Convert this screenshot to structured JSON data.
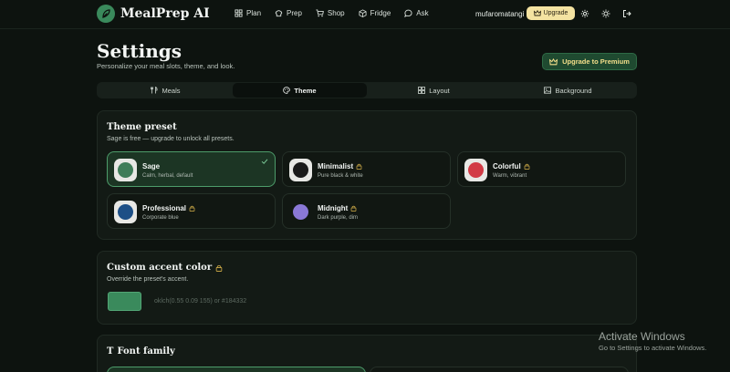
{
  "app": {
    "name": "MealPrep AI",
    "brand_color": "#3a8a5c",
    "accent_gold": "#f4e3a1"
  },
  "nav": {
    "items": [
      {
        "label": "Plan",
        "icon": "grid-icon"
      },
      {
        "label": "Prep",
        "icon": "chef-hat-icon"
      },
      {
        "label": "Shop",
        "icon": "cart-icon"
      },
      {
        "label": "Fridge",
        "icon": "box-icon"
      },
      {
        "label": "Ask",
        "icon": "chat-icon"
      }
    ],
    "username": "mufaromatangi",
    "upgrade_label": "Upgrade"
  },
  "header": {
    "title": "Settings",
    "subtitle": "Personalize your meal slots, theme, and look.",
    "premium_button": "Upgrade to Premium"
  },
  "tabs": [
    {
      "label": "Meals",
      "icon": "utensils-icon",
      "active": false
    },
    {
      "label": "Theme",
      "icon": "palette-icon",
      "active": true
    },
    {
      "label": "Layout",
      "icon": "layout-icon",
      "active": false
    },
    {
      "label": "Background",
      "icon": "image-icon",
      "active": false
    }
  ],
  "theme_preset": {
    "title": "Theme preset",
    "subtitle": "Sage is free — upgrade to unlock all presets.",
    "presets": [
      {
        "name": "Sage",
        "desc": "Calm, herbal, default",
        "color": "#3f7d59",
        "locked": false,
        "selected": true
      },
      {
        "name": "Minimalist",
        "desc": "Pure black & white",
        "color": "#1a1a1a",
        "locked": true,
        "selected": false
      },
      {
        "name": "Colorful",
        "desc": "Warm, vibrant",
        "color": "#d23a45",
        "locked": true,
        "selected": false
      },
      {
        "name": "Professional",
        "desc": "Corporate blue",
        "color": "#1d4f86",
        "locked": true,
        "selected": false
      },
      {
        "name": "Midnight",
        "desc": "Dark purple, dim",
        "color": "#8a78d6",
        "locked": true,
        "selected": false
      }
    ]
  },
  "custom_accent": {
    "title": "Custom accent color",
    "subtitle": "Override the preset's accent.",
    "swatch_color": "#3a8a5c",
    "placeholder": "oklch(0.55 0.09 155) or #184332"
  },
  "font_family": {
    "title": "Font family"
  },
  "watermark": {
    "title": "Activate Windows",
    "subtitle": "Go to Settings to activate Windows."
  }
}
